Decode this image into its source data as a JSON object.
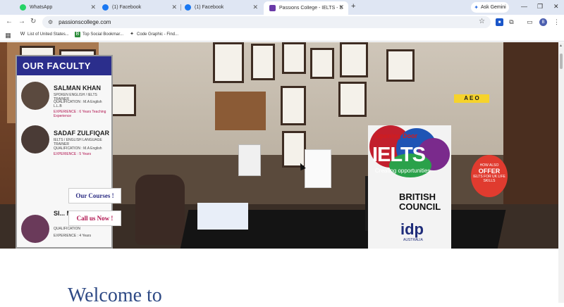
{
  "browser": {
    "tabs": [
      {
        "title": "WhatsApp",
        "favicon": "whatsapp-icon",
        "color": "#25d366"
      },
      {
        "title": "(1) Facebook",
        "favicon": "facebook-icon",
        "color": "#1877f2"
      },
      {
        "title": "(1) Facebook",
        "favicon": "facebook-icon",
        "color": "#1877f2"
      },
      {
        "title": "Passions College - IELTS - Spok",
        "favicon": "site-icon",
        "color": "#6a3aa8"
      }
    ],
    "new_tab": "+",
    "ask_gemini": "Ask Gemini",
    "address": "passionscollege.com",
    "profile_initial": "B",
    "bookmarks": [
      {
        "label": "List of United States...",
        "icon": "W"
      },
      {
        "label": "Top Social Bookmar...",
        "icon": "B"
      },
      {
        "label": "Code Graphic - Find...",
        "icon": "✦"
      }
    ]
  },
  "hero": {
    "faculty_title": "OUR FACULTY",
    "faculty": [
      {
        "name": "SALMAN KHAN",
        "info1": "SPOKEN ENGLISH / IELTS TRAINER",
        "info2": "QUALIFICATION : M.A English L.L.B",
        "info3": "EXPERIENCE : 6 Years Teaching Experience"
      },
      {
        "name": "SADAF ZULFIQAR",
        "info1": "IELTS / ENGLISH LANGUAGE TRAINER",
        "info2": "QUALIFICATION : M.A English",
        "info3": "EXPERIENCE : 5 Years"
      },
      {
        "name": "SI... MUNIR",
        "info1": "QUALIFICATION",
        "info2": "EXPERIENCE : 4 Years",
        "info3": ""
      }
    ],
    "ielts_poster": {
      "opening": "Opening Door",
      "brand": "IELTS",
      "tagline": "Creating opportunities",
      "british_council": "BRITISH COUNCIL",
      "idp": "idp",
      "idp_sub": "AUSTRALIA"
    },
    "aeo": "A E O",
    "offer_line1": "HOW ALSO",
    "offer_line2": "OFFER",
    "offer_line3": "IELTS FOR UK LIFE SKILLS",
    "buttons": {
      "courses": "Our Courses !",
      "call": "Call us Now !"
    }
  },
  "content": {
    "welcome": "Welcome to"
  }
}
